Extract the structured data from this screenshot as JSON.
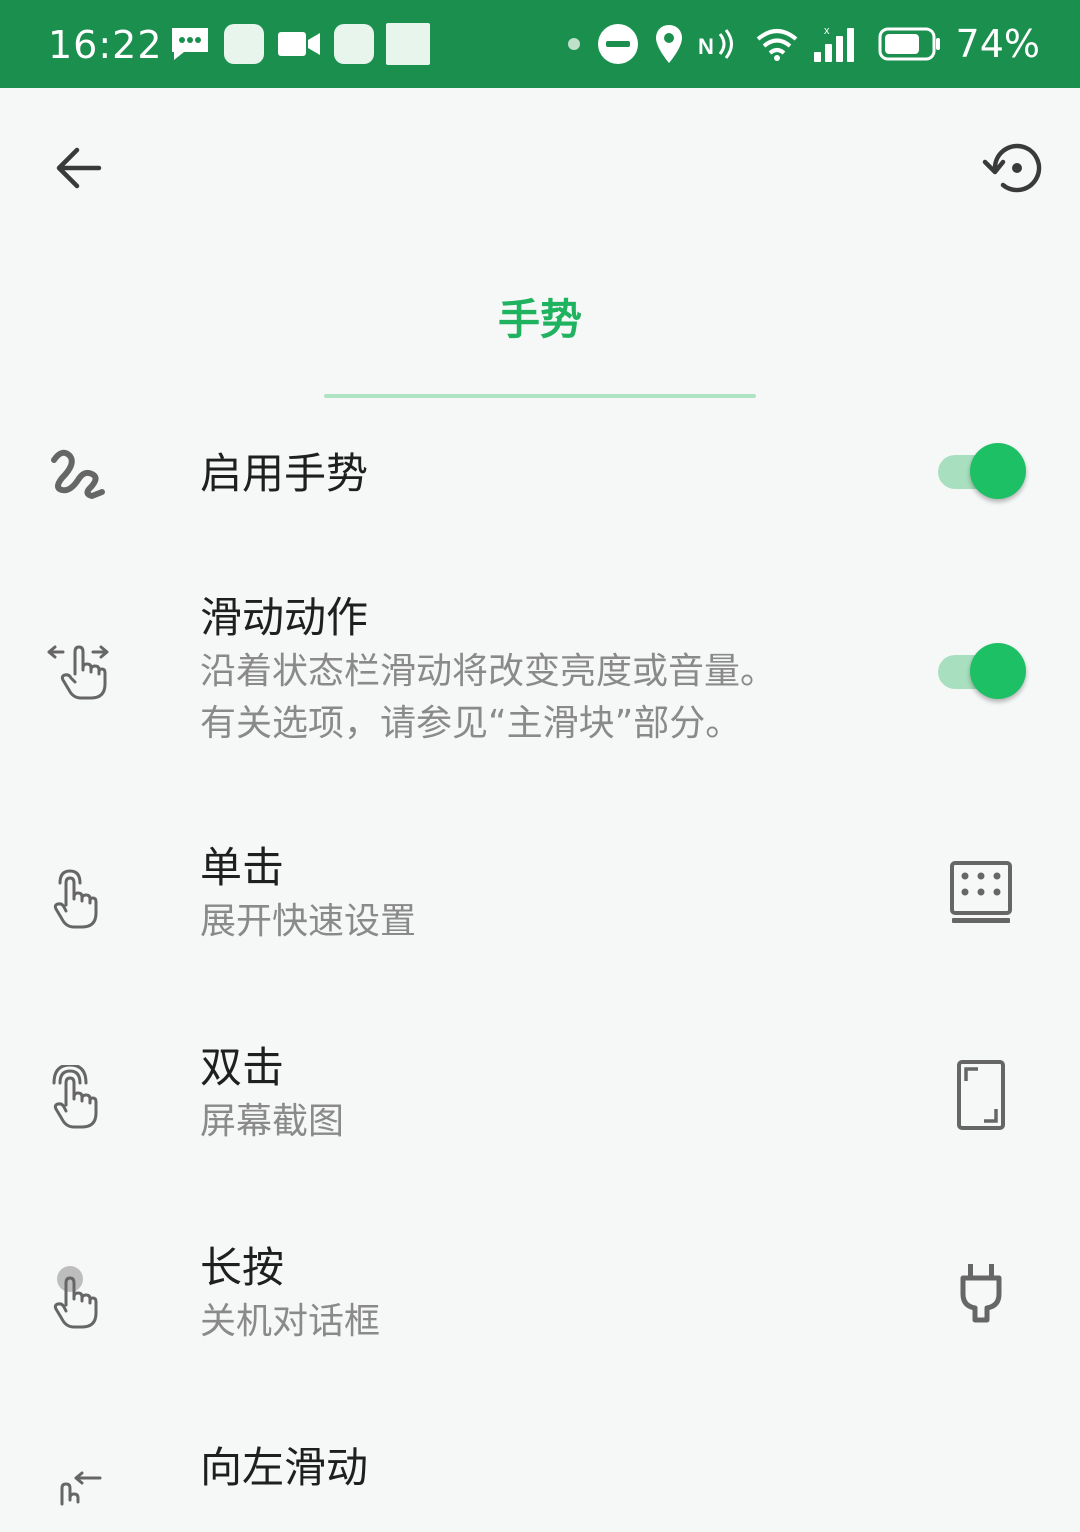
{
  "status_bar": {
    "time": "16:22",
    "battery_percent": "74%",
    "background_color": "#1b8f4e",
    "icons_left": [
      "message-icon",
      "app-icon",
      "video-icon",
      "app-icon",
      "app-icon"
    ],
    "icons_right": [
      "dot-icon",
      "do-not-disturb-icon",
      "location-icon",
      "nfc-icon",
      "wifi-icon",
      "signal-icon",
      "battery-icon"
    ]
  },
  "header": {
    "back_icon": "arrow-left-icon",
    "reset_icon": "restore-icon"
  },
  "tab": {
    "label": "手势",
    "accent_color": "#1fb25f"
  },
  "settings": [
    {
      "id": "enable",
      "title": "启用手势",
      "subtitle": "",
      "icon": "gesture-squiggle-icon",
      "right": "toggle",
      "on": true
    },
    {
      "id": "swipe",
      "title": "滑动动作",
      "subtitle": "沿着状态栏滑动将改变亮度或音量。",
      "subtitle2": "有关选项，请参见“主滑块”部分。",
      "icon": "swipe-horizontal-hand-icon",
      "right": "toggle",
      "on": true
    },
    {
      "id": "tap",
      "title": "单击",
      "subtitle": "展开快速设置",
      "icon": "tap-hand-icon",
      "right_icon": "quick-settings-grid-icon"
    },
    {
      "id": "double_tap",
      "title": "双击",
      "subtitle": "屏幕截图",
      "icon": "double-tap-hand-icon",
      "right_icon": "screenshot-icon"
    },
    {
      "id": "long_press",
      "title": "长按",
      "subtitle": "关机对话框",
      "icon": "long-press-hand-icon",
      "right_icon": "power-plug-icon"
    },
    {
      "id": "swipe_left",
      "title": "向左滑动",
      "subtitle": "",
      "icon": "swipe-left-hand-icon"
    }
  ]
}
